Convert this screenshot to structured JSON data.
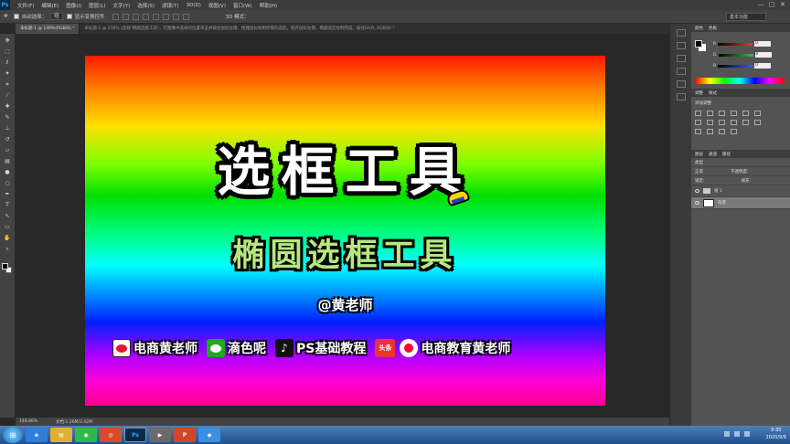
{
  "window": {
    "app_logo": "Ps",
    "menu": [
      "文件(F)",
      "编辑(E)",
      "图像(I)",
      "图层(L)",
      "文字(Y)",
      "选择(S)",
      "滤镜(T)",
      "3D(D)",
      "视图(V)",
      "窗口(W)",
      "帮助(H)"
    ],
    "controls": [
      "—",
      "▢",
      "✕"
    ]
  },
  "options_bar": {
    "auto_select_label": "自动选择：",
    "auto_select_value": "组",
    "show_transform_label": "显示变换控件",
    "mode_3d_label": "3D 模式：",
    "workspace": "基本功能"
  },
  "tabs": {
    "active": "未标题-1 @ 149%(RGB/8) *",
    "other": "未标题-2 @ 230% (选择\"椭圆选框工具\"，在图像中选择的位置单击并按住鼠标左键，拖拽鼠标绘制所需的选区，松开鼠标左键，椭圆选区绘制完成，按住Shift, RGB/8) *"
  },
  "canvas": {
    "title": "选框工具",
    "subtitle": "椭圆选框工具",
    "author": "@黄老师",
    "socials": [
      {
        "icon": "weibo-icon",
        "label": "电商黄老师"
      },
      {
        "icon": "wechat-icon",
        "label": "滴色呢"
      },
      {
        "icon": "tiktok-icon",
        "label": "PS基础教程"
      },
      {
        "icon": "toutiao-icon",
        "label": "电商教育黄老师",
        "badge": "头条"
      }
    ]
  },
  "status_bar": {
    "zoom": "148.86%",
    "doc": "文档:1.26M/3.42M"
  },
  "panels": {
    "color_tabs": [
      "颜色",
      "色板"
    ],
    "channels": [
      {
        "label": "R",
        "value": "0",
        "color": "#e23a3a"
      },
      {
        "label": "G",
        "value": "0",
        "color": "#35c435"
      },
      {
        "label": "B",
        "value": "0",
        "color": "#3a5de2"
      }
    ],
    "adjust_tabs": [
      "调整",
      "样式"
    ],
    "adjust_label": "添加调整",
    "layers_tabs": [
      "图层",
      "通道",
      "路径"
    ],
    "kind_label": "类型",
    "mode": "正常",
    "opacity_label": "不透明度:",
    "lock_label": "锁定:",
    "fill_label": "填充:",
    "layers": [
      {
        "name": "组 1",
        "type": "group"
      },
      {
        "name": "背景",
        "type": "image"
      }
    ]
  },
  "taskbar": {
    "start": "⊞",
    "apps": [
      {
        "icon": "ie-icon",
        "label": "e",
        "color": "#2f7fd8"
      },
      {
        "icon": "folder-icon",
        "label": "▤",
        "color": "#e0b030"
      },
      {
        "icon": "wechat-app-icon",
        "label": "◉",
        "color": "#2fb94b"
      },
      {
        "icon": "chrome-icon",
        "label": "◎",
        "color": "#d84a2f"
      },
      {
        "icon": "photoshop-icon",
        "label": "Ps",
        "color": "#0b2a4a",
        "active": true
      },
      {
        "icon": "media-icon",
        "label": "▶",
        "color": "#6a6a6a"
      },
      {
        "icon": "powerpoint-icon",
        "label": "P",
        "color": "#d24726"
      },
      {
        "icon": "app-icon",
        "label": "◆",
        "color": "#3a8fe0"
      }
    ],
    "time": "9:30",
    "date": "2020/9/9"
  }
}
